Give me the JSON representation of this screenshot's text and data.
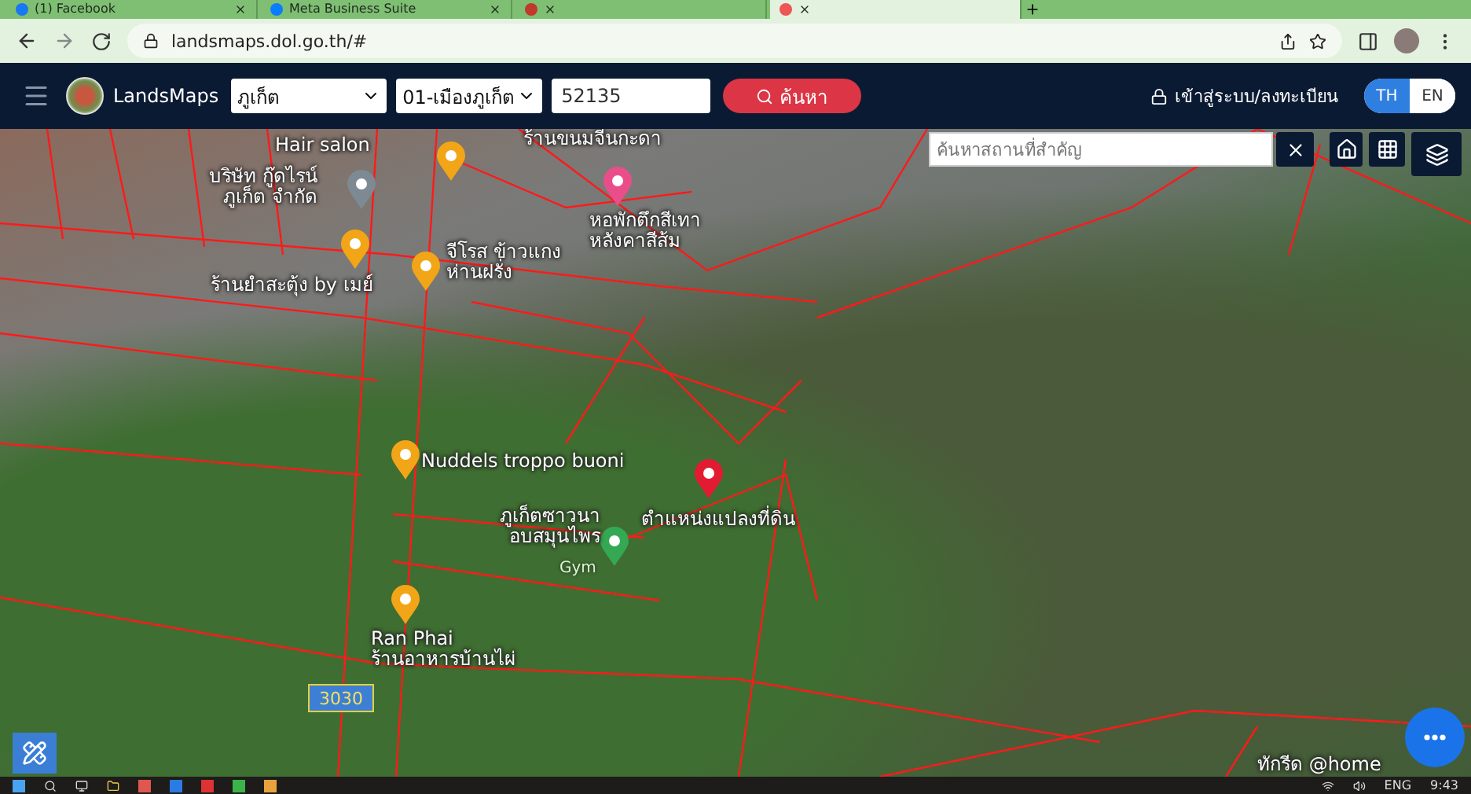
{
  "browser": {
    "tabs": [
      {
        "title": "(1) Facebook",
        "selected": false
      },
      {
        "title": "Meta Business Suite",
        "selected": false
      },
      {
        "selected": false
      },
      {
        "selected": true
      }
    ],
    "url": "landsmaps.dol.go.th/#"
  },
  "header": {
    "brand": "LandsMaps",
    "province": "ภูเก็ต",
    "district": "01-เมืองภูเก็ต",
    "parcel_number": "52135",
    "search_button": "ค้นหา",
    "login": "เข้าสู่ระบบ/ลงทะเบียน",
    "languages": [
      {
        "label": "TH",
        "selected": true
      },
      {
        "label": "EN",
        "selected": false
      }
    ]
  },
  "map": {
    "search": {
      "placeholder": "ค้นหาสถานที่สำคัญ"
    },
    "places": [
      {
        "kind": "text",
        "label": [
          "Hair salon"
        ]
      },
      {
        "kind": "place",
        "label": [
          "บริษัท กู๊ดไรน์",
          "ภูเก็ต จำกัด"
        ]
      },
      {
        "kind": "text",
        "label": [
          "ร้านขนมจีนกะดา"
        ]
      },
      {
        "kind": "food"
      },
      {
        "kind": "hotel",
        "label": [
          "หอพักตึกสีเทา",
          "หลังคาสีส้ม"
        ]
      },
      {
        "kind": "food",
        "label": [
          "ร้านยำสะตุ้ง by เมย์"
        ]
      },
      {
        "kind": "food",
        "label": [
          "จีโรส ข้าวแกง",
          "ห่านฝรั่ง"
        ]
      },
      {
        "kind": "food",
        "label": [
          "Nuddels troppo buoni"
        ]
      },
      {
        "kind": "gym",
        "label": [
          "ภูเก็ตซาวนา",
          "อบสมุนไพร"
        ],
        "category": "Gym"
      },
      {
        "kind": "parcel",
        "label": [
          "ตำแหน่งแปลงที่ดิน"
        ]
      },
      {
        "kind": "food",
        "label": [
          "Ran Phai",
          "ร้านอาหารบ้านไผ่"
        ]
      },
      {
        "kind": "text",
        "label": [
          "ทักรีด @home"
        ]
      }
    ],
    "road_sign": "3030"
  },
  "taskbar": {
    "language": "ENG",
    "time": "9:43"
  }
}
